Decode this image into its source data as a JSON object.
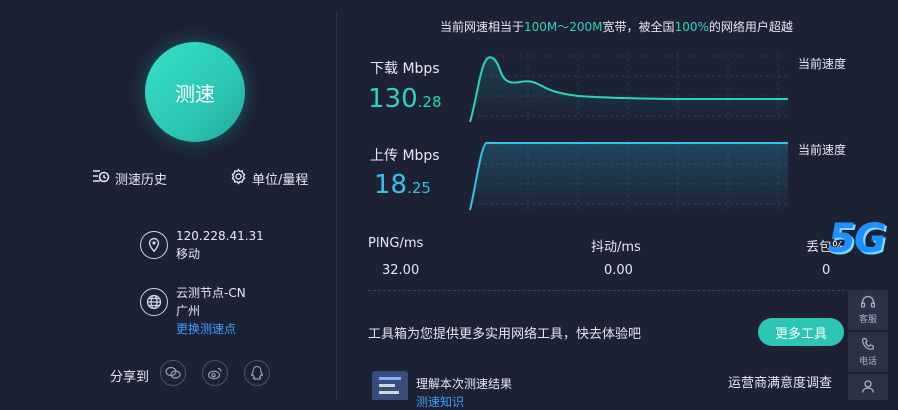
{
  "left": {
    "speed_button": "测速",
    "history": "测速历史",
    "units": "单位/量程",
    "ip": "120.228.41.31",
    "isp": "移动",
    "node": "云测节点-CN",
    "city": "广州",
    "change_node": "更换测速点",
    "share_label": "分享到"
  },
  "right": {
    "caption_prefix": "当前网速相当于",
    "caption_range": "100M～200M",
    "caption_mid": "宽带，被全国",
    "caption_pct": "100%",
    "caption_suffix": "的网络用户超越",
    "download_label": "下载 Mbps",
    "download_int": "130",
    "download_dec": ".28",
    "upload_label": "上传 Mbps",
    "upload_int": "18",
    "upload_dec": ".25",
    "current_speed": "当前速度",
    "ping_label": "PING/ms",
    "ping_value": "32.00",
    "jitter_label": "抖动/ms",
    "jitter_value": "0.00",
    "loss_label": "丢包%",
    "loss_value": "0",
    "toolbox_text": "工具箱为您提供更多实用网络工具，快去体验吧",
    "more_tools": "更多工具",
    "understand_result": "理解本次测速结果",
    "understand_sub": "测速知识",
    "survey": "运营商满意度调查",
    "badge_5g": "5G"
  },
  "side": {
    "service": "客服",
    "phone": "电话"
  },
  "colors": {
    "accent": "#2bc7b4",
    "download_value": "#2bd4bd",
    "upload_value": "#30c4e6",
    "link": "#3aa0ff",
    "background": "#1c2134"
  }
}
